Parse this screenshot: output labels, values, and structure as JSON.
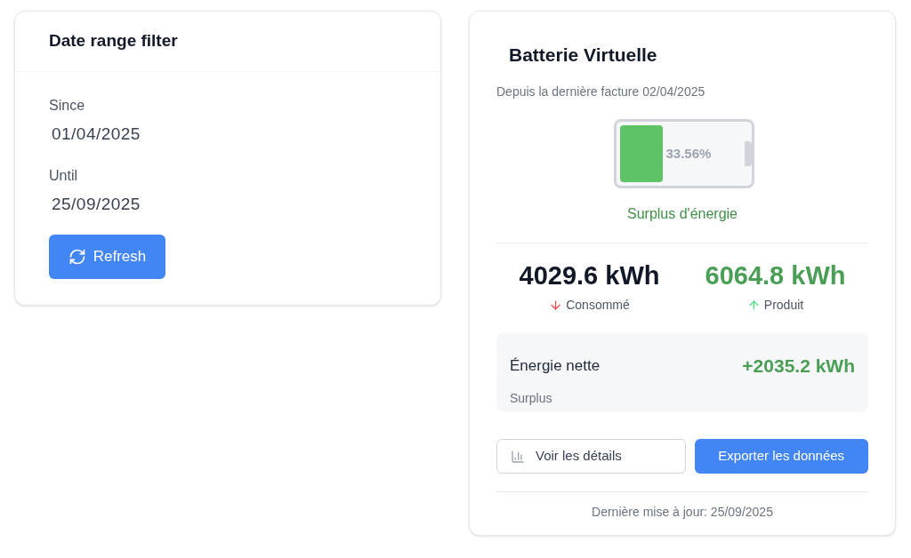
{
  "filter": {
    "title": "Date range filter",
    "fields": [
      {
        "label": "Since",
        "value": "01/04/2025"
      },
      {
        "label": "Until",
        "value": "25/09/2025"
      }
    ],
    "refresh_button": "Refresh"
  },
  "battery": {
    "title": "Batterie Virtuelle",
    "subtitle": "Depuis la dernière facture 02/04/2025",
    "percent": "33.56%",
    "status": "Surplus d'énergie",
    "stats": [
      {
        "kind": "down",
        "value": "4029.6 kWh",
        "label": "Consommé"
      },
      {
        "kind": "up",
        "value": "6064.8 kWh",
        "label": "Produit"
      }
    ],
    "net": {
      "label": "Énergie nette",
      "value": "+2035.2 kWh",
      "note": "Surplus"
    },
    "details_button": "Voir les détails",
    "export_button": "Exporter les données",
    "updated": "Dernière mise à jour: 25/09/2025"
  }
}
